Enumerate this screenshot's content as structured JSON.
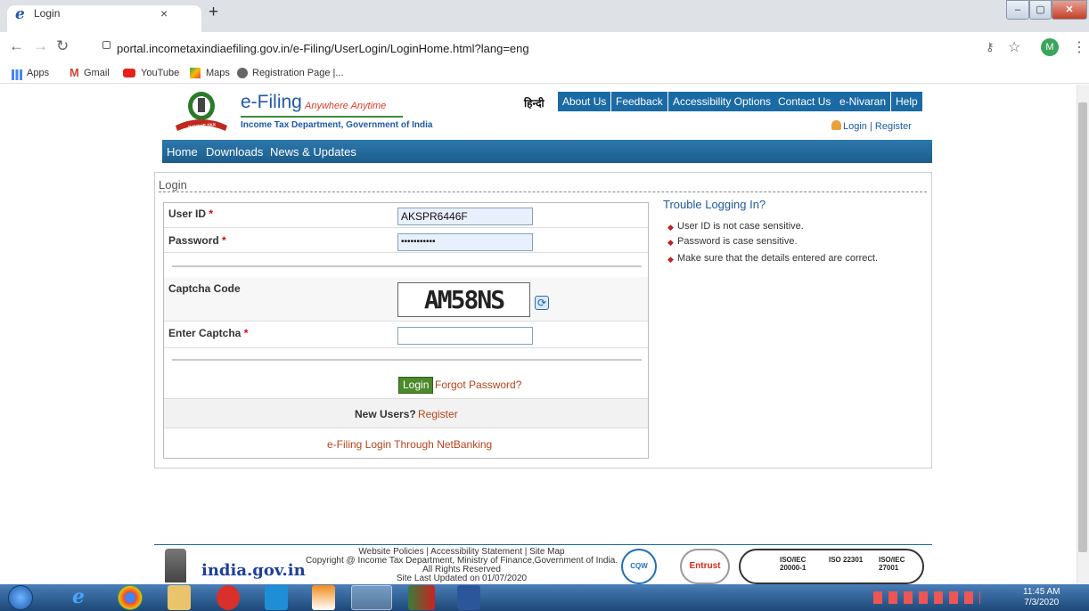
{
  "browser": {
    "tab_title": "Login",
    "tab_close": "×",
    "new_tab": "+",
    "url": "portal.incometaxindiaefiling.gov.in/e-Filing/UserLogin/LoginHome.html?lang=eng",
    "profile_initial": "M",
    "bookmarks": [
      "Apps",
      "Gmail",
      "YouTube",
      "Maps",
      "Registration Page |..."
    ]
  },
  "header": {
    "title": "e-Filing",
    "tagline": "Anywhere Anytime",
    "subtitle": "Income Tax Department, Government of India",
    "emblem_text": "INCOME TAX DEPARTMENT",
    "hindi_link": "हिन्दी",
    "top_links": [
      "About Us",
      "Feedback",
      "Accessibility Options",
      "Contact Us",
      "e-Nivaran",
      "Help"
    ],
    "login_register": "Login | Register"
  },
  "nav": {
    "items": [
      "Home",
      "Downloads",
      "News & Updates"
    ]
  },
  "login": {
    "heading": "Login",
    "user_id_label": "User ID",
    "user_id_value": "AKSPR6446F",
    "password_label": "Password",
    "password_value": "•••••••••••",
    "captcha_label": "Captcha Code",
    "captcha_text": "AM58NS",
    "enter_captcha_label": "Enter Captcha",
    "enter_captcha_value": "",
    "required_mark": "*",
    "login_button": "Login",
    "forgot_password": "Forgot Password?",
    "new_users": "New Users?",
    "register": "Register",
    "netbanking": "e-Filing Login Through NetBanking"
  },
  "trouble": {
    "heading": "Trouble Logging In?",
    "tips": [
      "User ID is not case sensitive.",
      "Password is case sensitive.",
      "Make sure that the details entered are correct."
    ]
  },
  "footer": {
    "links": "Website Policies  |  Accessibility Statement  |  Site Map",
    "copyright": "Copyright @ Income Tax Department, Ministry of Finance,Government of India.",
    "rights": "All Rights Reserved",
    "updated": "Site Last Updated on 01/07/2020",
    "india_gov": "india.gov.in",
    "badges": [
      "CQW",
      "Entrust",
      "ISO/IEC 20000-1",
      "ISO 22301",
      "ISO/IEC 27001"
    ]
  },
  "taskbar": {
    "time": "11:45 AM",
    "date": "7/3/2020"
  },
  "colors": {
    "nav_blue": "#1b5d8c",
    "link_orange": "#b8421c",
    "login_green": "#4c8a2a"
  }
}
